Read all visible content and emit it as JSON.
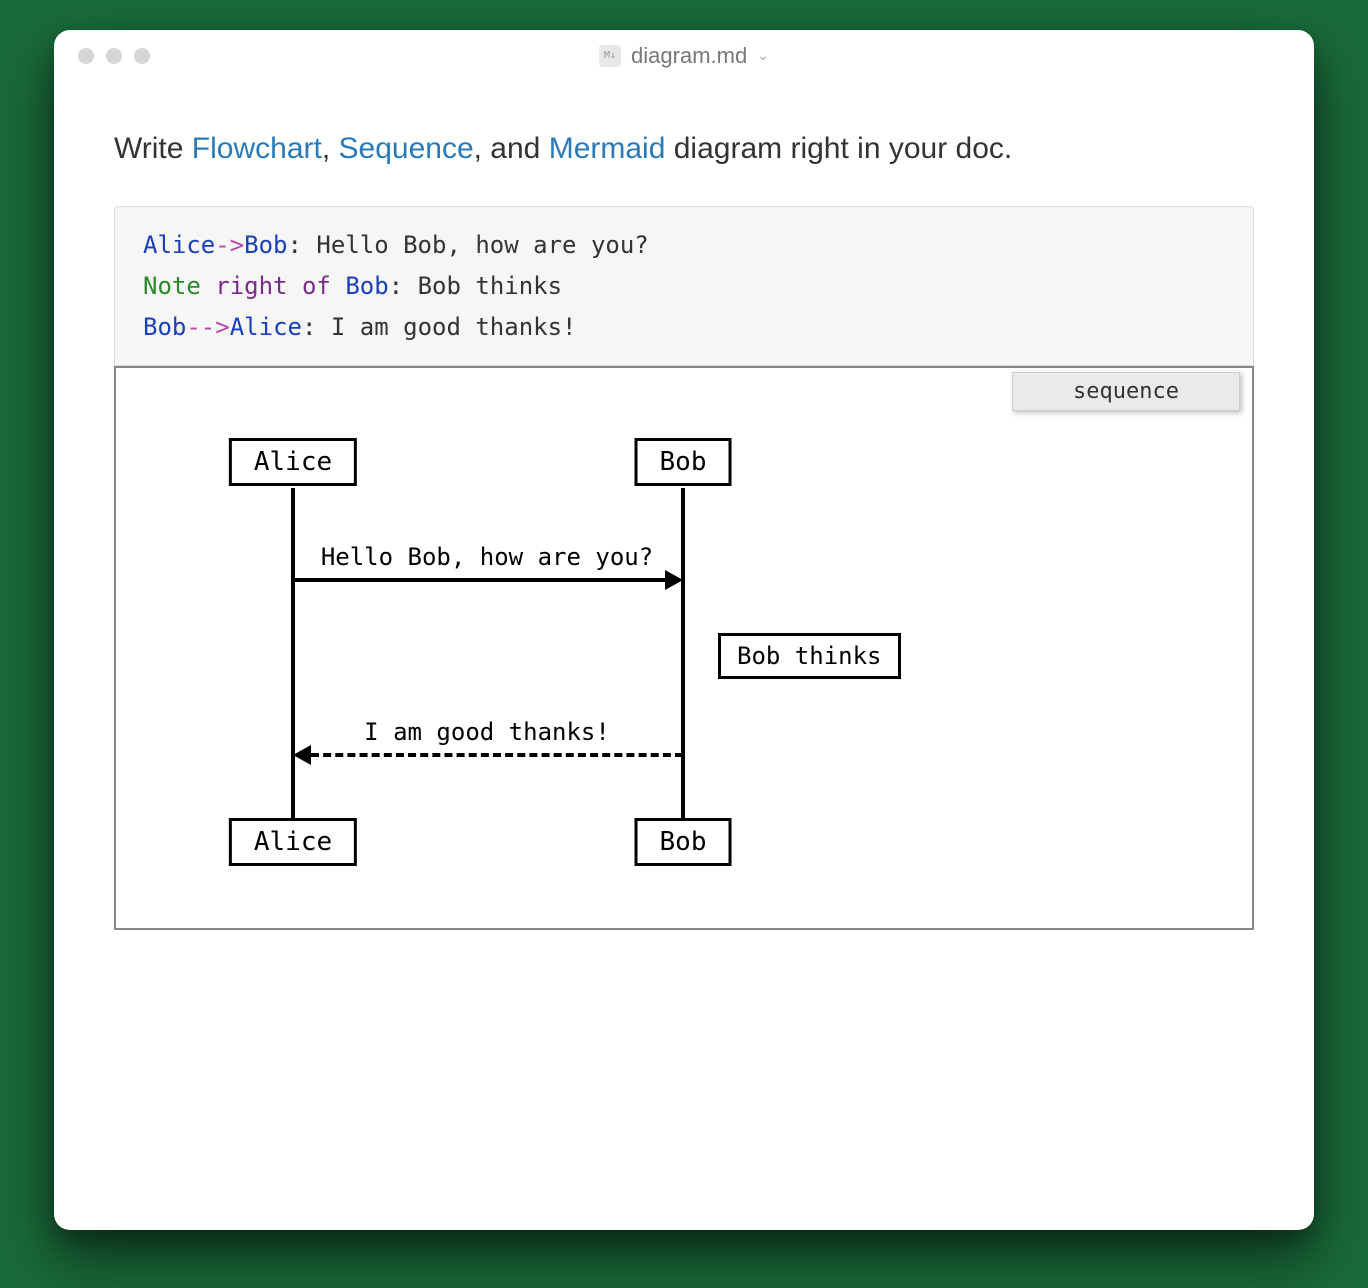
{
  "titlebar": {
    "filename": "diagram.md",
    "file_badge": "M↓"
  },
  "intro": {
    "prefix": "Write ",
    "link_flowchart": "Flowchart",
    "sep1": ", ",
    "link_sequence": "Sequence",
    "sep2": ", and ",
    "link_mermaid": "Mermaid",
    "suffix": " diagram right in your doc."
  },
  "code": {
    "lines": [
      {
        "actor1": "Alice",
        "arrow": "->",
        "actor2": "Bob",
        "rest": ": Hello Bob, how are you?"
      },
      {
        "note": "Note",
        "right": "right",
        "of": "of",
        "actor": "Bob",
        "rest": ": Bob thinks"
      },
      {
        "actor1": "Bob",
        "arrow": "-->",
        "actor2": "Alice",
        "rest": ": I am good thanks!"
      }
    ]
  },
  "diagram": {
    "badge": "sequence",
    "actors": [
      "Alice",
      "Bob"
    ],
    "messages": [
      {
        "from": "Alice",
        "to": "Bob",
        "text": "Hello Bob, how are you?",
        "style": "solid"
      },
      {
        "note_right_of": "Bob",
        "text": "Bob thinks"
      },
      {
        "from": "Bob",
        "to": "Alice",
        "text": "I am good thanks!",
        "style": "dashed"
      }
    ]
  },
  "chart_data": {
    "type": "sequence",
    "actors": [
      "Alice",
      "Bob"
    ],
    "events": [
      {
        "kind": "message",
        "from": "Alice",
        "to": "Bob",
        "text": "Hello Bob, how are you?",
        "line": "solid"
      },
      {
        "kind": "note",
        "placement": "right of",
        "actor": "Bob",
        "text": "Bob thinks"
      },
      {
        "kind": "message",
        "from": "Bob",
        "to": "Alice",
        "text": "I am good thanks!",
        "line": "dashed"
      }
    ]
  }
}
